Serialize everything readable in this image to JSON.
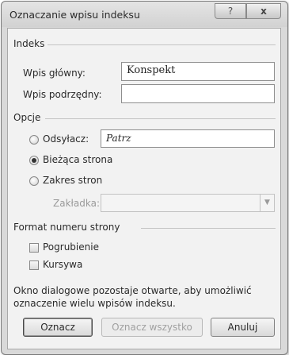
{
  "window": {
    "title": "Oznaczanie wpisu indeksu",
    "help_glyph": "?",
    "close_glyph": "x"
  },
  "index": {
    "heading": "Indeks",
    "main_entry_label": "Wpis główny:",
    "main_entry_value": "Konspekt",
    "subentry_label": "Wpis podrzędny:",
    "subentry_value": ""
  },
  "options": {
    "heading": "Opcje",
    "cross_ref_label": "Odsyłacz:",
    "cross_ref_value": "Patrz",
    "current_page_label": "Bieżąca strona",
    "page_range_label": "Zakres stron",
    "bookmark_label": "Zakładka:",
    "bookmark_value": "",
    "selected": "current_page"
  },
  "page_number_format": {
    "heading": "Format numeru strony",
    "bold_label": "Pogrubienie",
    "bold_checked": false,
    "italic_label": "Kursywa",
    "italic_checked": false
  },
  "info_text": "Okno dialogowe pozostaje otwarte, aby umożliwić oznaczenie wielu wpisów indeksu.",
  "buttons": {
    "mark": "Oznacz",
    "mark_all": "Oznacz wszystko",
    "cancel": "Anuluj"
  },
  "icons": {
    "dropdown_arrow": "chevron-down-icon"
  }
}
